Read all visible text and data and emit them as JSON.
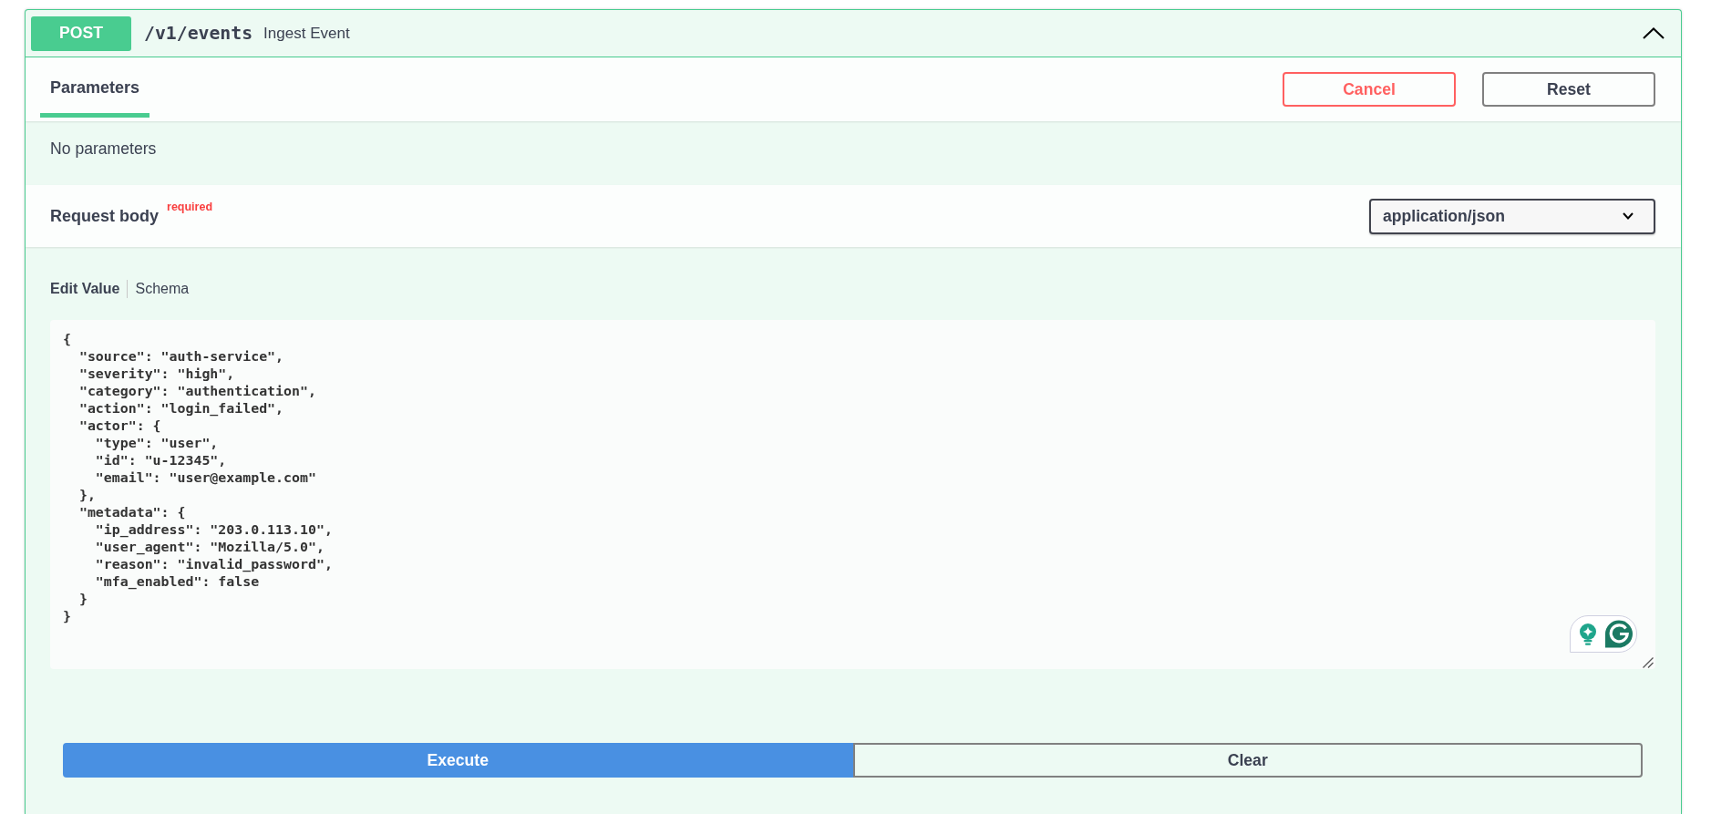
{
  "operation": {
    "method": "POST",
    "path": "/v1/events",
    "summary": "Ingest Event",
    "expanded": true
  },
  "parameters": {
    "tabs": [
      {
        "label": "Parameters",
        "selected": true
      }
    ],
    "buttons": [
      {
        "label": "Cancel",
        "kind": "cancel"
      },
      {
        "label": "Reset",
        "kind": "reset"
      }
    ],
    "empty_text": "No parameters"
  },
  "request_body": {
    "title": "Request body",
    "required_label": "required",
    "content_type": "application/json"
  },
  "editor": {
    "tabs": [
      {
        "label": "Edit Value",
        "selected": true
      },
      {
        "label": "Schema",
        "selected": false
      }
    ],
    "value": "{\n  \"source\": \"auth-service\",\n  \"severity\": \"high\",\n  \"category\": \"authentication\",\n  \"action\": \"login_failed\",\n  \"actor\": {\n    \"type\": \"user\",\n    \"id\": \"u-12345\",\n    \"email\": \"user@example.com\"\n  },\n  \"metadata\": {\n    \"ip_address\": \"203.0.113.10\",\n    \"user_agent\": \"Mozilla/5.0\",\n    \"reason\": \"invalid_password\",\n    \"mfa_enabled\": false\n  }\n}"
  },
  "actions": [
    {
      "label": "Execute",
      "kind": "execute"
    },
    {
      "label": "Clear",
      "kind": "clear"
    }
  ]
}
